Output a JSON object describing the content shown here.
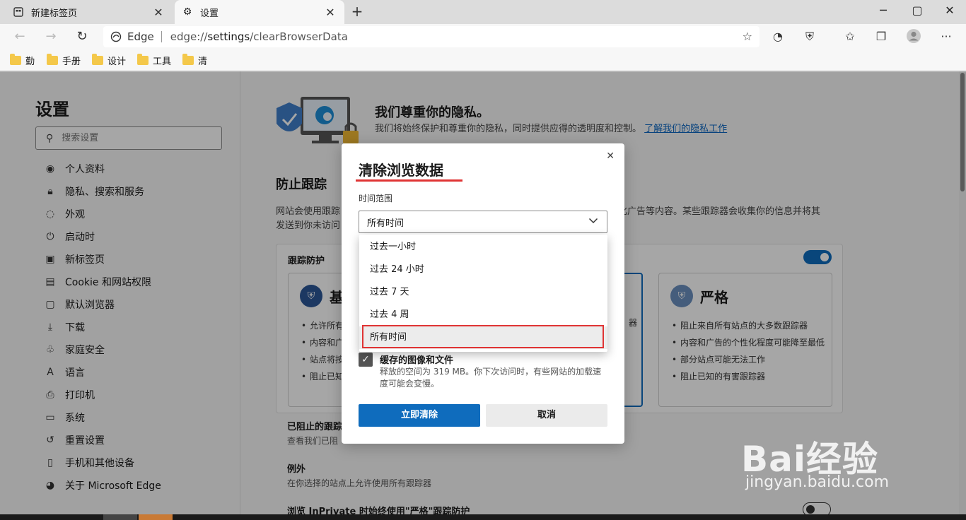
{
  "tabs": [
    {
      "label": "新建标签页",
      "icon": "new-tab-page-icon"
    },
    {
      "label": "设置",
      "icon": "gear-icon"
    }
  ],
  "window_controls": {
    "minimize": "─",
    "maximize": "▢",
    "close": "✕"
  },
  "address": {
    "brand": "Edge",
    "url_prefix": "edge://",
    "url_main": "settings",
    "url_suffix": "/clearBrowserData"
  },
  "favorites": [
    "勤",
    "手册",
    "设计",
    "工具",
    "清"
  ],
  "settings": {
    "title": "设置",
    "search_placeholder": "搜索设置",
    "nav": [
      {
        "label": "个人资料",
        "icon": "profile-icon"
      },
      {
        "label": "隐私、搜索和服务",
        "icon": "lock-icon"
      },
      {
        "label": "外观",
        "icon": "palette-icon"
      },
      {
        "label": "启动时",
        "icon": "power-icon"
      },
      {
        "label": "新标签页",
        "icon": "new-tab-icon"
      },
      {
        "label": "Cookie 和网站权限",
        "icon": "cookie-icon"
      },
      {
        "label": "默认浏览器",
        "icon": "browser-icon"
      },
      {
        "label": "下载",
        "icon": "download-icon"
      },
      {
        "label": "家庭安全",
        "icon": "family-icon"
      },
      {
        "label": "语言",
        "icon": "language-icon"
      },
      {
        "label": "打印机",
        "icon": "printer-icon"
      },
      {
        "label": "系统",
        "icon": "system-icon"
      },
      {
        "label": "重置设置",
        "icon": "reset-icon"
      },
      {
        "label": "手机和其他设备",
        "icon": "phone-icon"
      },
      {
        "label": "关于 Microsoft Edge",
        "icon": "edge-icon"
      }
    ]
  },
  "privacy": {
    "hero_title": "我们尊重你的隐私。",
    "hero_desc": "我们将始终保护和尊重你的隐私，同时提供应得的透明度和控制。",
    "hero_link": "了解我们的隐私工作",
    "tracking_title": "防止跟踪",
    "tracking_desc_a": "网站会使用跟踪",
    "tracking_desc_b": "性化广告等内容。某些跟踪器会收集你的信息并将其",
    "tracking_desc_c": "发送到你未访问",
    "card_title": "跟踪防护",
    "basic": {
      "title": "基",
      "items": [
        "允许所有",
        "内容和广",
        "站点将按",
        "阻止已知"
      ]
    },
    "strict": {
      "title": "严格",
      "items": [
        "阻止来自所有站点的大多数跟踪器",
        "内容和广告的个性化程度可能降至最低",
        "部分站点可能无法工作",
        "阻止已知的有害跟踪器"
      ]
    },
    "balanced_tail": "器",
    "blocked_title": "已阻止的跟踪",
    "blocked_desc": "查看我们已阻",
    "exceptions_title": "例外",
    "exceptions_desc": "在你选择的站点上允许使用所有跟踪器",
    "inprivate_title": "浏览 InPrivate 时始终使用\"严格\"跟踪防护"
  },
  "dialog": {
    "title": "清除浏览数据",
    "time_range_label": "时间范围",
    "selected": "所有时间",
    "options": [
      "过去一小时",
      "过去 24 小时",
      "过去 7 天",
      "过去 4 周",
      "所有时间"
    ],
    "cache_label": "缓存的图像和文件",
    "cache_desc": "释放的空间为 319 MB。你下次访问时，有些网站的加载速度可能会变慢。",
    "clear_button": "立即清除",
    "cancel_button": "取消"
  },
  "watermark": {
    "line1": "Bai经验",
    "line2": "jingyan.baidu.com"
  },
  "colors": {
    "accent": "#0f6cbd",
    "highlight": "#e03434",
    "folder": "#f4c84a"
  }
}
